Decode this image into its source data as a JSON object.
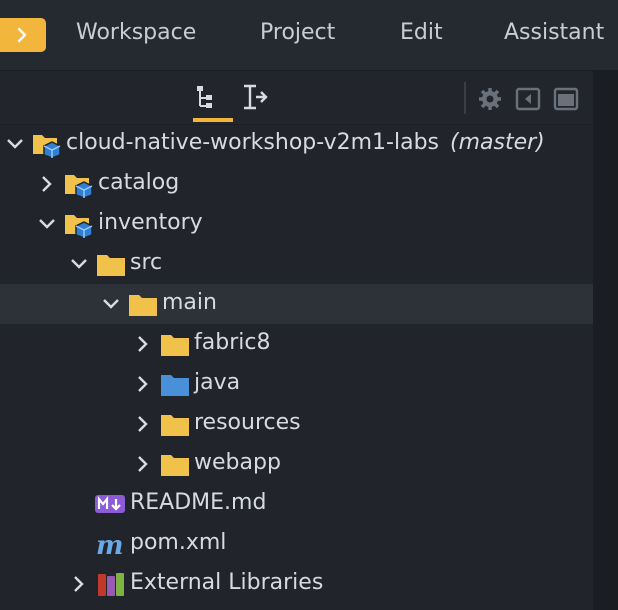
{
  "menubar": {
    "items": [
      "Workspace",
      "Project",
      "Edit",
      "Assistant"
    ]
  },
  "toolbar": {
    "tabs": [
      {
        "icon": "project-tree-icon",
        "active": true
      },
      {
        "icon": "structure-icon",
        "active": false
      }
    ],
    "actions": [
      "gear-icon",
      "collapse-left-icon",
      "maximize-panel-icon"
    ]
  },
  "tree": {
    "root": {
      "label": "cloud-native-workshop-v2m1-labs",
      "branch": "(master)"
    },
    "items": [
      {
        "label": "catalog"
      },
      {
        "label": "inventory"
      },
      {
        "label": "src"
      },
      {
        "label": "main"
      },
      {
        "label": "fabric8"
      },
      {
        "label": "java"
      },
      {
        "label": "resources"
      },
      {
        "label": "webapp"
      },
      {
        "label": "README.md"
      },
      {
        "label": "pom.xml"
      },
      {
        "label": "External Libraries"
      }
    ]
  },
  "colors": {
    "accent": "#f2b63d",
    "folder": "#f0c14b",
    "java_folder": "#4a90d9",
    "module_badge": "#2f7fd6",
    "markdown": "#8b5cd6",
    "maven": "#6aa8e8"
  }
}
